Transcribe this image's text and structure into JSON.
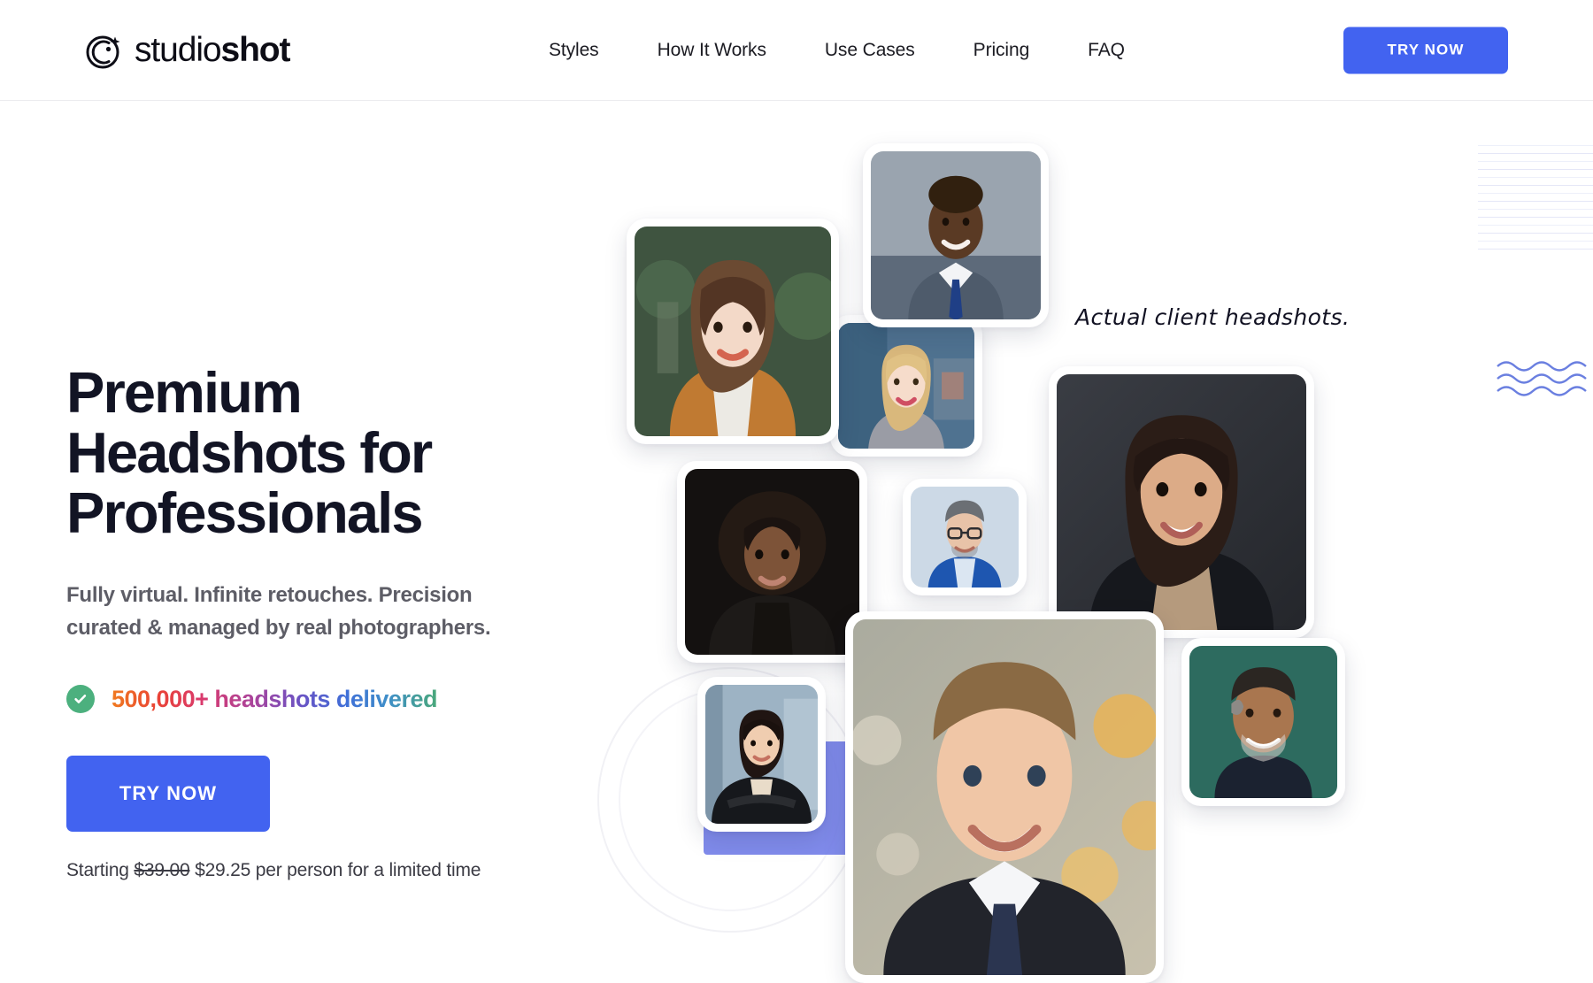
{
  "brand": {
    "name_light": "studio",
    "name_bold": "shot",
    "logo_icon": "camera-sparkle-icon"
  },
  "header": {
    "nav": [
      {
        "label": "Styles"
      },
      {
        "label": "How It Works"
      },
      {
        "label": "Use Cases"
      },
      {
        "label": "Pricing"
      },
      {
        "label": "FAQ"
      }
    ],
    "cta_label": "TRY NOW"
  },
  "hero": {
    "title_line1": "Premium",
    "title_line2": "Headshots for",
    "title_line3": "Professionals",
    "subtitle": "Fully virtual. Infinite retouches. Precision curated & managed by real photographers.",
    "badge": {
      "icon": "check-circle-icon",
      "text": "500,000+ headshots delivered",
      "icon_color": "#4cb07e"
    },
    "cta_label": "TRY NOW",
    "price": {
      "prefix": "Starting",
      "old_price": "$39.00",
      "new_price": "$29.25",
      "suffix": "per person for a limited time"
    }
  },
  "collage": {
    "caption": "Actual client headshots.",
    "cards": [
      {
        "name": "headshot-man-navy-suit",
        "bg": "#8e99a6"
      },
      {
        "name": "headshot-woman-tan-blazer",
        "bg": "#3f5440"
      },
      {
        "name": "headshot-woman-blonde",
        "bg": "#51708a"
      },
      {
        "name": "headshot-woman-dark-bg",
        "bg": "#15120f"
      },
      {
        "name": "headshot-man-glasses-blue",
        "bg": "#c9d6e4"
      },
      {
        "name": "headshot-woman-navy-bg",
        "bg": "#2f3238"
      },
      {
        "name": "headshot-woman-asian-suit",
        "bg": "#8fa6b8"
      },
      {
        "name": "headshot-man-bokeh-bg",
        "bg": "#b9b3a4"
      },
      {
        "name": "headshot-man-teal-bg",
        "bg": "#2d6b5f"
      }
    ]
  },
  "theme": {
    "accent_blue": "#4263f0",
    "text_dark": "#121424",
    "text_gray": "#5d5d66",
    "deco_purple": "#6a77e8",
    "deco_wave": "#6a7fe0"
  }
}
